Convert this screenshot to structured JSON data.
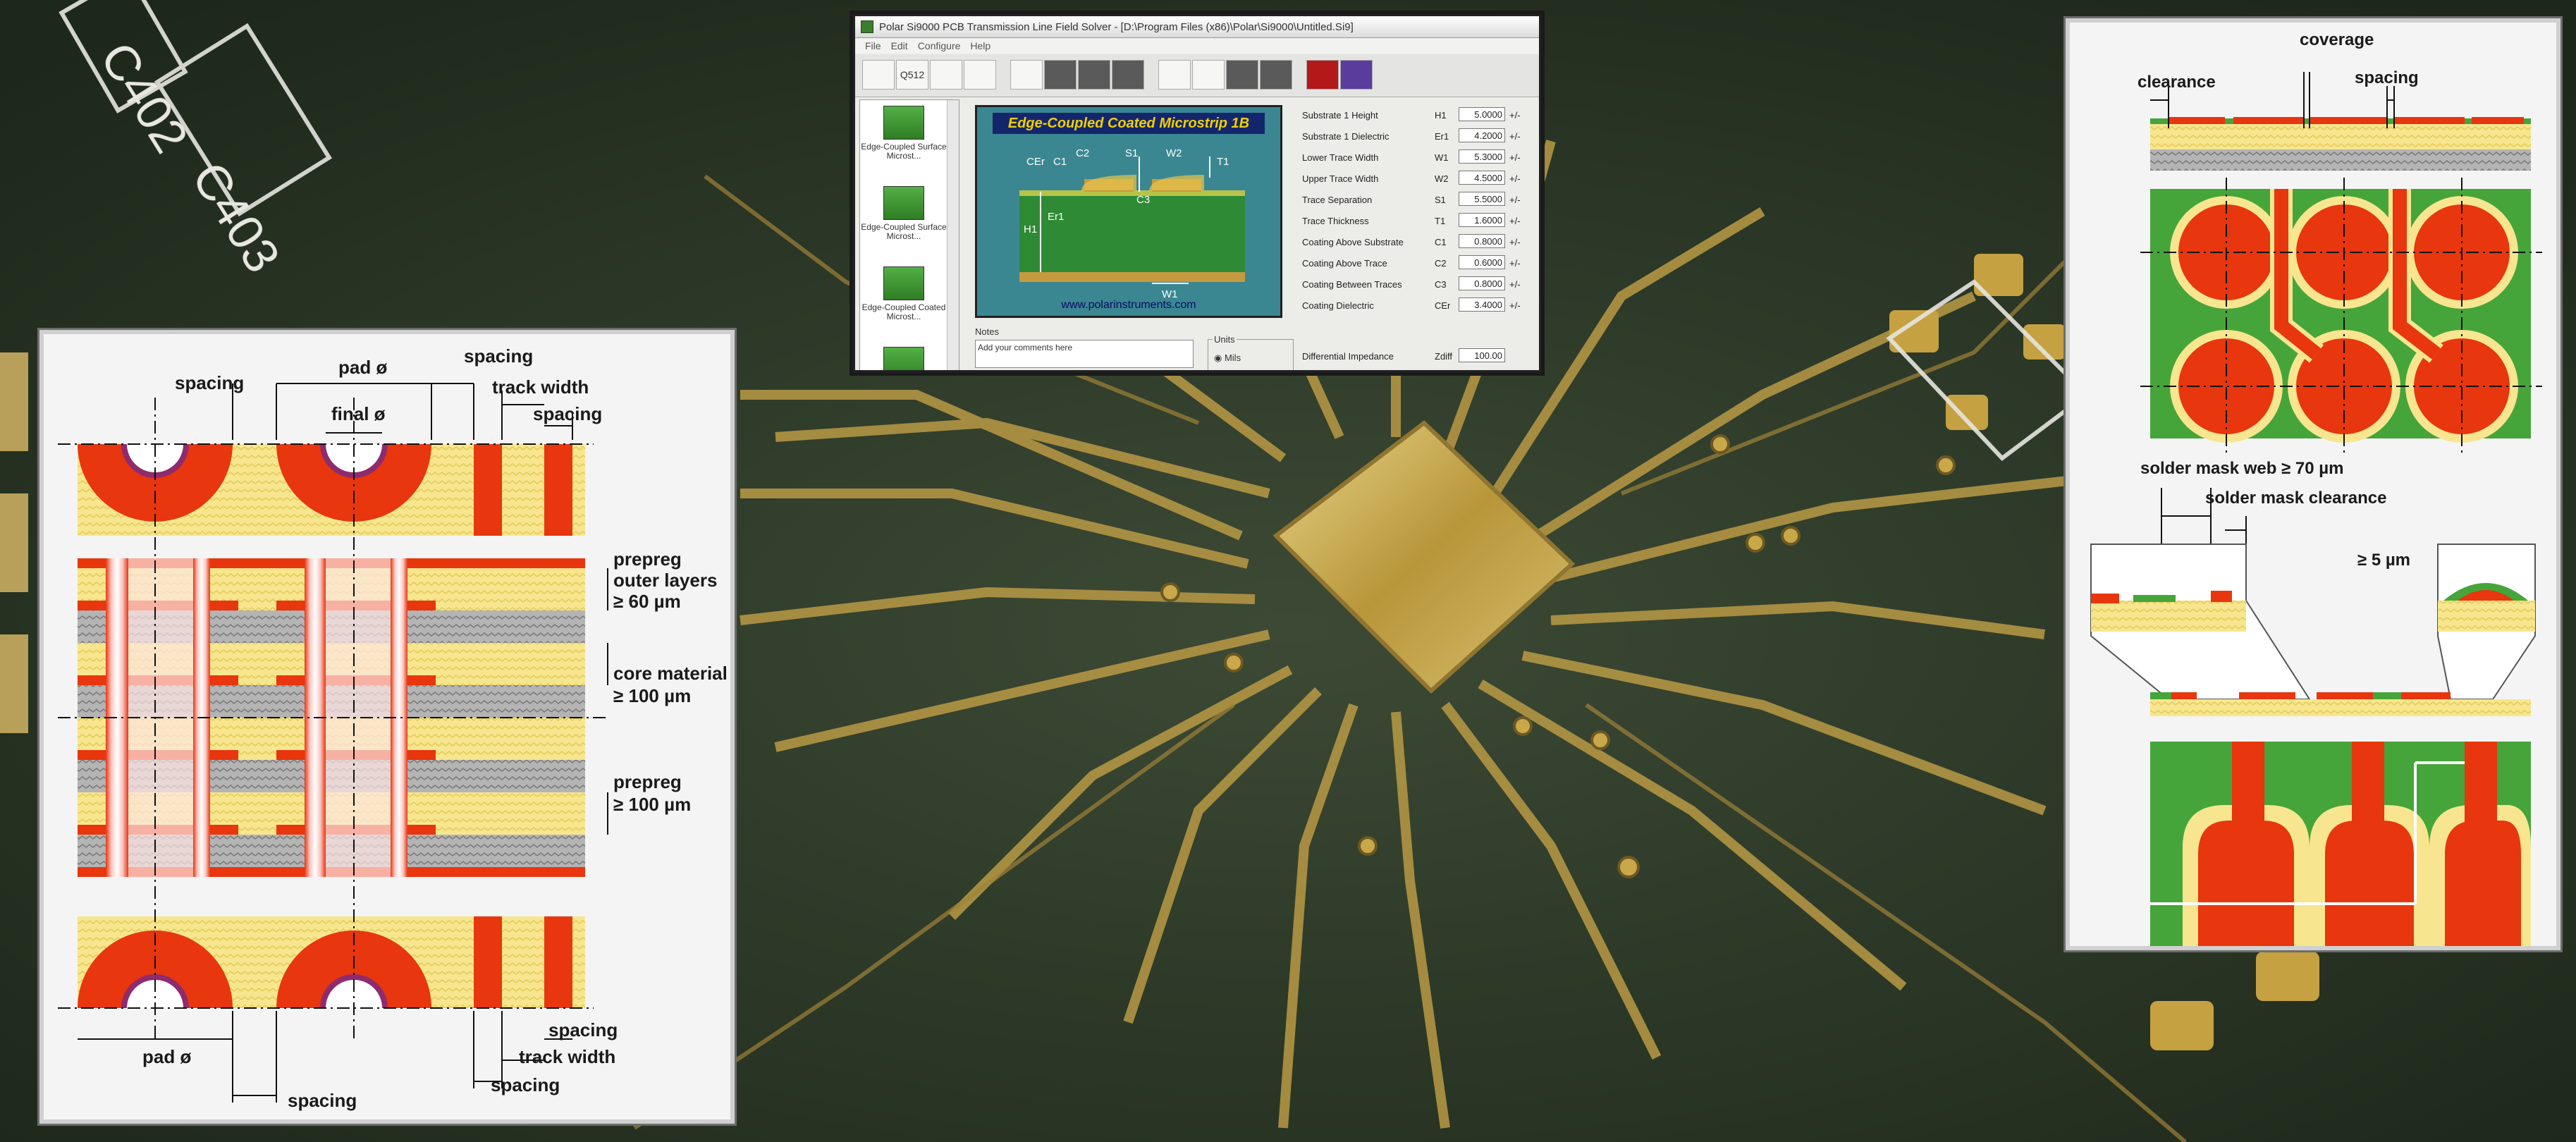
{
  "window": {
    "title": "Polar Si9000 PCB Transmission Line Field Solver - [D:\\Program Files (x86)\\Polar\\Si9000\\Untitled.Si9]",
    "menu": [
      "File",
      "Edit",
      "Configure",
      "Help"
    ],
    "toolbar_icon_label": "Q512",
    "list_items": [
      {
        "label": "Edge-Coupled Surface Microst..."
      },
      {
        "label": "Edge-Coupled Surface Microst..."
      },
      {
        "label": "Edge-Coupled Coated Microst..."
      }
    ],
    "diagram": {
      "title": "Edge-Coupled Coated Microstrip 1B",
      "url": "www.polarinstruments.com",
      "labels": {
        "cer": "CEr",
        "c1": "C1",
        "c2": "C2",
        "s1": "S1",
        "w2": "W2",
        "t1": "T1",
        "c3": "C3",
        "h1": "H1",
        "er1": "Er1",
        "w1": "W1"
      }
    },
    "params": [
      {
        "name": "Substrate 1 Height",
        "sym": "H1",
        "value": "5.0000",
        "mod": "+/-"
      },
      {
        "name": "Substrate 1 Dielectric",
        "sym": "Er1",
        "value": "4.2000",
        "mod": "+/-"
      },
      {
        "name": "Lower Trace Width",
        "sym": "W1",
        "value": "5.3000",
        "mod": "+/-"
      },
      {
        "name": "Upper Trace Width",
        "sym": "W2",
        "value": "4.5000",
        "mod": "+/-"
      },
      {
        "name": "Trace Separation",
        "sym": "S1",
        "value": "5.5000",
        "mod": "+/-"
      },
      {
        "name": "Trace Thickness",
        "sym": "T1",
        "value": "1.6000",
        "mod": "+/-"
      },
      {
        "name": "Coating Above Substrate",
        "sym": "C1",
        "value": "0.8000",
        "mod": "+/-"
      },
      {
        "name": "Coating Above Trace",
        "sym": "C2",
        "value": "0.6000",
        "mod": "+/-"
      },
      {
        "name": "Coating Between Traces",
        "sym": "C3",
        "value": "0.8000",
        "mod": "+/-"
      },
      {
        "name": "Coating Dielectric",
        "sym": "CEr",
        "value": "3.4000",
        "mod": "+/-"
      }
    ],
    "notes_label": "Notes",
    "notes_placeholder": "Add your comments here",
    "units_label": "Units",
    "units_option": "Mils",
    "zdiff": {
      "name": "Differential Impedance",
      "sym": "Zdiff",
      "value": "100.00"
    }
  },
  "left_diagram": {
    "labels": {
      "spacing_top": "spacing",
      "pad_top": "pad ø",
      "final": "final ø",
      "spacing_top_right": "spacing",
      "track_width_top": "track width",
      "spacing_right": "spacing",
      "prepreg_outer_1": "prepreg",
      "prepreg_outer_2": "outer layers",
      "prepreg_outer_3": "≥ 60 µm",
      "core_1": "core material",
      "core_2": "≥ 100 µm",
      "prepreg_1": "prepreg",
      "prepreg_2": "≥ 100 µm",
      "spacing_bottom_right": "spacing",
      "track_width_bottom": "track width",
      "spacing_bottom_mid": "spacing",
      "pad_bottom": "pad ø",
      "spacing_bottom": "spacing"
    }
  },
  "right_diagram": {
    "labels": {
      "coverage": "coverage",
      "clearance": "clearance",
      "spacing": "spacing",
      "web": "solder mask web ≥ 70 µm",
      "mask_clearance": "solder mask clearance",
      "min5": "≥ 5 µm"
    }
  },
  "board": {
    "silk_1": "C402",
    "silk_2": "C403"
  },
  "colors": {
    "board_green": "#2c3a27",
    "gold": "#c7a646",
    "copper_red": "#e8360e",
    "solder_green": "#45a53a",
    "yellow": "#f6e58e"
  }
}
